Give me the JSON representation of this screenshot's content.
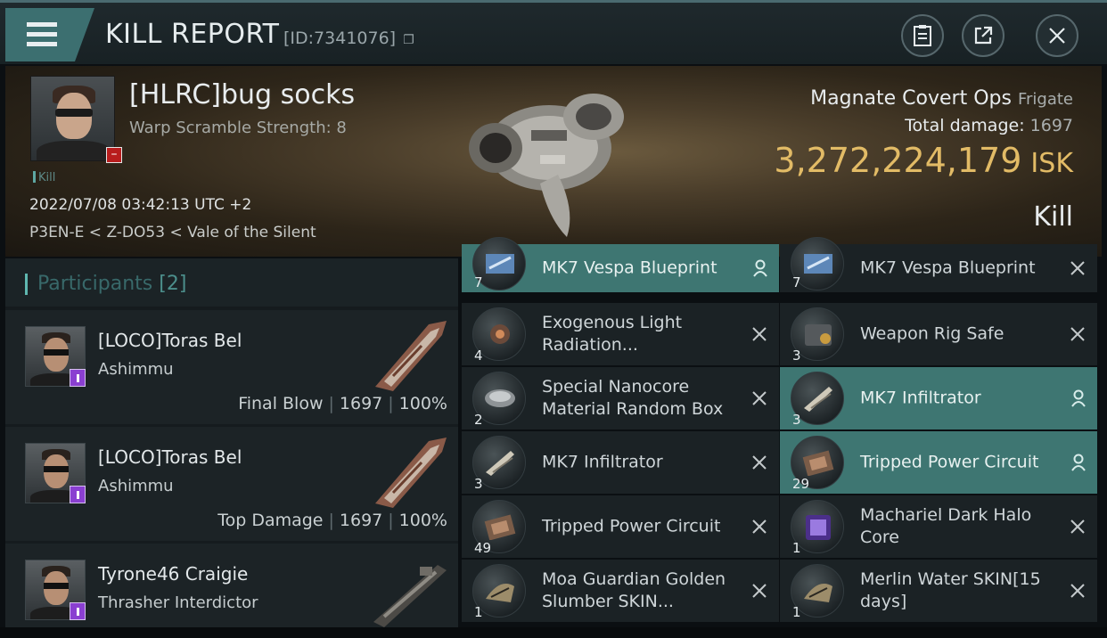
{
  "header": {
    "title": "KILL REPORT",
    "id_text": "[ID:7341076]"
  },
  "victim": {
    "name": "[HLRC]bug socks",
    "subtitle": "Warp Scramble Strength: 8",
    "kill_tag": "Kill",
    "datetime": "2022/07/08 03:42:13 UTC +2",
    "location": "P3EN-E < Z-DO53 < Vale of the Silent",
    "ship_name": "Magnate Covert Ops",
    "ship_class": "Frigate",
    "total_damage_label": "Total damage:",
    "total_damage_value": "1697",
    "isk_value": "3,272,224,179",
    "isk_unit": "ISK",
    "result_label": "Kill"
  },
  "participants": {
    "label": "Participants",
    "count": "[2]",
    "list": [
      {
        "name": "[LOCO]Toras Bel",
        "ship": "Ashimmu",
        "role": "Final Blow",
        "damage": "1697",
        "percent": "100%"
      },
      {
        "name": "[LOCO]Toras Bel",
        "ship": "Ashimmu",
        "role": "Top Damage",
        "damage": "1697",
        "percent": "100%"
      },
      {
        "name": "Tyrone46 Craigie",
        "ship": "Thrasher Interdictor"
      }
    ]
  },
  "items": {
    "left": [
      {
        "qty": "7",
        "name": "MK7 Vespa Blueprint",
        "highlight": true,
        "icon": "blueprint-icon"
      },
      {
        "qty": "4",
        "name": "Exogenous Light Radiation...",
        "highlight": false,
        "icon": "radiation-icon"
      },
      {
        "qty": "2",
        "name": "Special Nanocore Material Random Box",
        "highlight": false,
        "icon": "box-icon"
      },
      {
        "qty": "3",
        "name": "MK7  Infiltrator",
        "highlight": false,
        "icon": "drone-icon"
      },
      {
        "qty": "49",
        "name": "Tripped Power Circuit",
        "highlight": false,
        "icon": "circuit-icon"
      },
      {
        "qty": "1",
        "name": "Moa Guardian Golden Slumber SKIN...",
        "highlight": false,
        "icon": "skin-icon"
      }
    ],
    "right": [
      {
        "qty": "7",
        "name": "MK7 Vespa Blueprint",
        "highlight": false,
        "icon": "blueprint-icon"
      },
      {
        "qty": "3",
        "name": "Weapon Rig Safe",
        "highlight": false,
        "icon": "safe-icon"
      },
      {
        "qty": "3",
        "name": "MK7  Infiltrator",
        "highlight": true,
        "icon": "drone-icon"
      },
      {
        "qty": "29",
        "name": "Tripped Power Circuit",
        "highlight": true,
        "icon": "circuit-icon"
      },
      {
        "qty": "1",
        "name": "Machariel Dark Halo Core",
        "highlight": false,
        "icon": "core-icon"
      },
      {
        "qty": "1",
        "name": "Merlin Water SKIN[15 days]",
        "highlight": false,
        "icon": "skin-icon"
      }
    ]
  },
  "colors": {
    "accent": "#3e7672",
    "isk": "#e2bb66",
    "badge_purple": "#8a3fd1",
    "minus_red": "#b81d1d"
  }
}
